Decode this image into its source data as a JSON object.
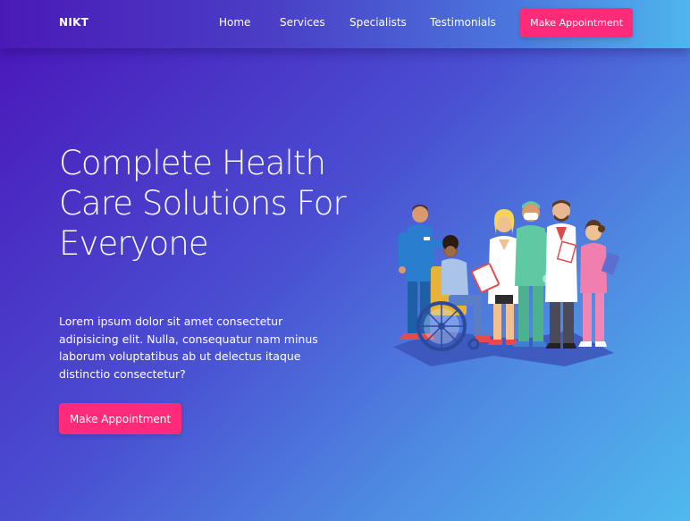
{
  "brand": {
    "name": "NIKT"
  },
  "nav": {
    "items": [
      {
        "label": "Home"
      },
      {
        "label": "Services"
      },
      {
        "label": "Specialists"
      },
      {
        "label": "Testimonials"
      }
    ],
    "cta_label": "Make Appointment"
  },
  "hero": {
    "title": "Complete Health Care Solutions For Everyone",
    "description": "Lorem ipsum dolor sit amet consectetur adipisicing elit. Nulla, consequatur nam minus laborum voluptatibus ab ut delectus itaque distinctio consectetur?",
    "cta_label": "Make Appointment"
  },
  "colors": {
    "accent": "#ff2a79",
    "gradient_start": "#4a14b8",
    "gradient_end": "#4fb9ee"
  },
  "illustration": {
    "subject": "medical-team-illustration"
  }
}
